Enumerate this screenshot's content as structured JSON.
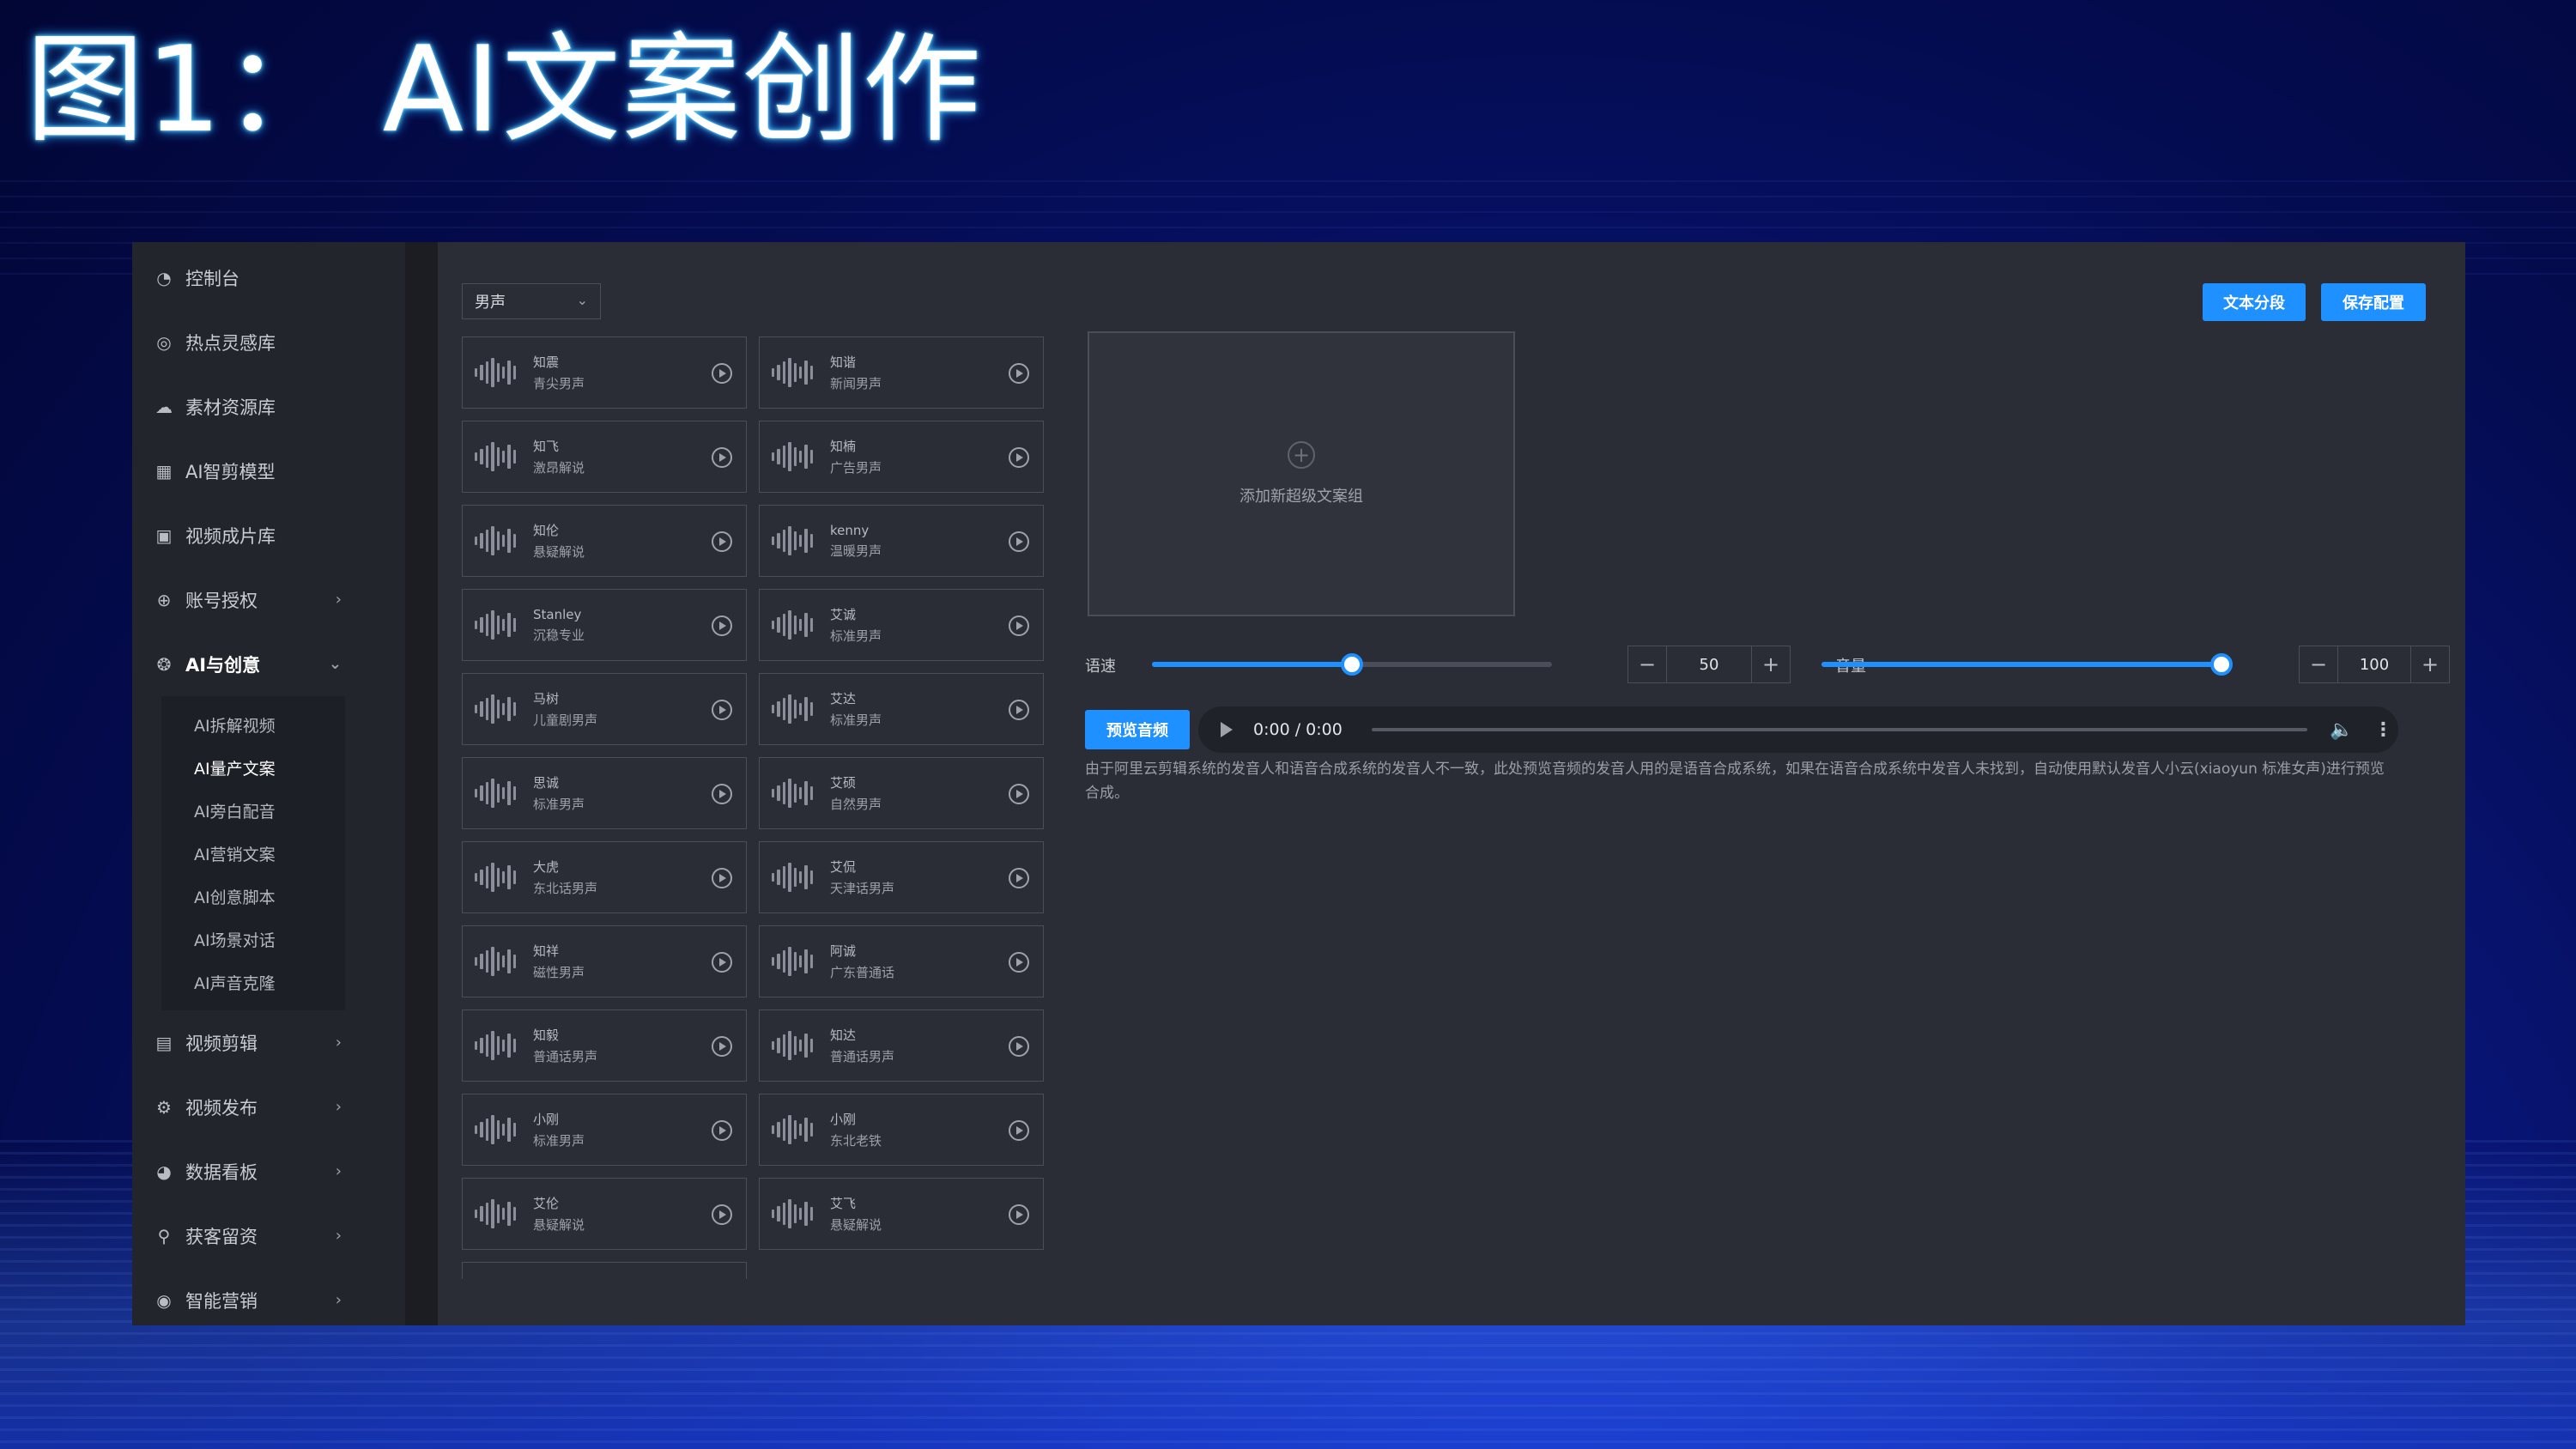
{
  "slide": {
    "title": "图1： AI文案创作"
  },
  "sidebar": {
    "items_top": [
      {
        "label": "控制台",
        "icon": "dashboard-icon"
      },
      {
        "label": "热点灵感库",
        "icon": "lightbulb-icon"
      },
      {
        "label": "素材资源库",
        "icon": "cloud-icon"
      },
      {
        "label": "AI智剪模型",
        "icon": "model-icon"
      },
      {
        "label": "视频成片库",
        "icon": "video-library-icon"
      },
      {
        "label": "账号授权",
        "icon": "target-icon"
      },
      {
        "label": "AI与创意",
        "icon": "brain-icon"
      }
    ],
    "submenu": [
      {
        "label": "AI拆解视频"
      },
      {
        "label": "AI量产文案"
      },
      {
        "label": "AI旁白配音"
      },
      {
        "label": "AI营销文案"
      },
      {
        "label": "AI创意脚本"
      },
      {
        "label": "AI场景对话"
      },
      {
        "label": "AI声音克隆"
      }
    ],
    "items_bottom": [
      {
        "label": "视频剪辑",
        "icon": "film-icon"
      },
      {
        "label": "视频发布",
        "icon": "publish-icon"
      },
      {
        "label": "数据看板",
        "icon": "pie-chart-icon"
      },
      {
        "label": "获客留资",
        "icon": "org-chart-icon"
      },
      {
        "label": "智能营销",
        "icon": "marketing-icon"
      }
    ]
  },
  "main": {
    "gender_select": "男声",
    "buttons": {
      "segment": "文本分段",
      "save": "保存配置",
      "preview": "预览音频"
    },
    "add_group": "添加新超级文案组",
    "speed": {
      "label": "语速",
      "value": "50",
      "fraction": 0.5
    },
    "volume": {
      "label": "音量",
      "value": "100",
      "fraction": 1.0
    },
    "audio": {
      "time": "0:00 / 0:00"
    },
    "note": "由于阿里云剪辑系统的发音人和语音合成系统的发音人不一致，此处预览音频的发音人用的是语音合成系统，如果在语音合成系统中发音人未找到，自动使用默认发音人小云(xiaoyun 标准女声)进行预览合成。",
    "voices": [
      {
        "name": "知震",
        "desc": "青尖男声"
      },
      {
        "name": "知谐",
        "desc": "新闻男声"
      },
      {
        "name": "知飞",
        "desc": "激昂解说"
      },
      {
        "name": "知楠",
        "desc": "广告男声"
      },
      {
        "name": "知伦",
        "desc": "悬疑解说"
      },
      {
        "name": "kenny",
        "desc": "温暖男声"
      },
      {
        "name": "Stanley",
        "desc": "沉稳专业"
      },
      {
        "name": "艾诚",
        "desc": "标准男声"
      },
      {
        "name": "马树",
        "desc": "儿童剧男声"
      },
      {
        "name": "艾达",
        "desc": "标准男声"
      },
      {
        "name": "思诚",
        "desc": "标准男声"
      },
      {
        "name": "艾硕",
        "desc": "自然男声"
      },
      {
        "name": "大虎",
        "desc": "东北话男声"
      },
      {
        "name": "艾侃",
        "desc": "天津话男声"
      },
      {
        "name": "知祥",
        "desc": "磁性男声"
      },
      {
        "name": "阿诚",
        "desc": "广东普通话"
      },
      {
        "name": "知毅",
        "desc": "普通话男声"
      },
      {
        "name": "知达",
        "desc": "普通话男声"
      },
      {
        "name": "小刚",
        "desc": "标准男声"
      },
      {
        "name": "小刚",
        "desc": "东北老铁"
      },
      {
        "name": "艾伦",
        "desc": "悬疑解说"
      },
      {
        "name": "艾飞",
        "desc": "悬疑解说"
      }
    ]
  }
}
